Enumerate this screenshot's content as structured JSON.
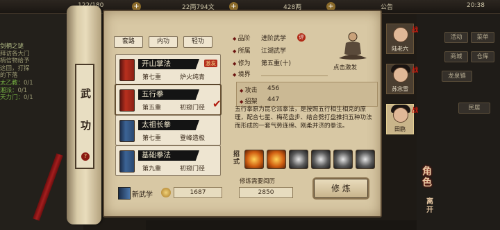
{
  "topbar": {
    "stamina": "122/180",
    "money": "22两794文",
    "gems": "428两",
    "notice": "公告",
    "time": "20:38"
  },
  "quest": {
    "title": "剑柄之谜",
    "lines": [
      "拜访各大门",
      "柄信物给予",
      "这回，打探",
      "的下落"
    ],
    "counters": [
      {
        "label": "太乙教：",
        "value": "0/1"
      },
      {
        "label": "湘派：",
        "value": "0/1"
      },
      {
        "label": "天力门：",
        "value": "0/1"
      }
    ]
  },
  "right_menu": {
    "buttons": [
      "活动",
      "菜单",
      "商城",
      "仓库"
    ],
    "location": "龙泉镇",
    "house": "民居"
  },
  "scroll": {
    "chars": [
      "武",
      "功"
    ]
  },
  "tabs": [
    "套路",
    "内功",
    "轻功"
  ],
  "skills": [
    {
      "name": "开山掌法",
      "level": "第七重",
      "state": "炉火纯青",
      "badge": "激发",
      "book": "red"
    },
    {
      "name": "五行拳",
      "level": "第五重",
      "state": "初窥门径",
      "book": "red"
    },
    {
      "name": "太祖长拳",
      "level": "第七重",
      "state": "登峰造极",
      "book": "blue"
    },
    {
      "name": "基础拳法",
      "level": "第九重",
      "state": "初窥门径",
      "book": "blue"
    }
  ],
  "checkmark": "✔",
  "info": {
    "grade_label": "品阶",
    "grade": "进阶武学",
    "grade_badge": "评",
    "faction_label": "所属",
    "faction": "江湖武学",
    "cultivation_label": "修为",
    "cultivation": "第五重(十)",
    "realm_label": "境界",
    "figure_label": "点击激发"
  },
  "stats": {
    "attack_label": "攻击",
    "attack": "456",
    "parry_label": "招架",
    "parry": "447"
  },
  "description": "五行拳原为昆仑派拳法，是按照五行相生相克的原理，配合七星、梅花盘步、结合劈打盘推扫五种功法而形成的一套气势连绵、刚柔并济的拳法。",
  "moves_label": "招式",
  "moves": [
    "f",
    "f",
    "d",
    "d",
    "d",
    "d"
  ],
  "requirement": {
    "label": "修练需要阅历",
    "value": "2850"
  },
  "train_label": "修 炼",
  "new_skill_label": "新武学",
  "coin_value": "1687",
  "characters": [
    {
      "name": "陆老六"
    },
    {
      "name": "苏念雪"
    },
    {
      "name": "田鹏"
    }
  ],
  "char_flag": "战",
  "role_label": "角色",
  "leave_label": "离开"
}
